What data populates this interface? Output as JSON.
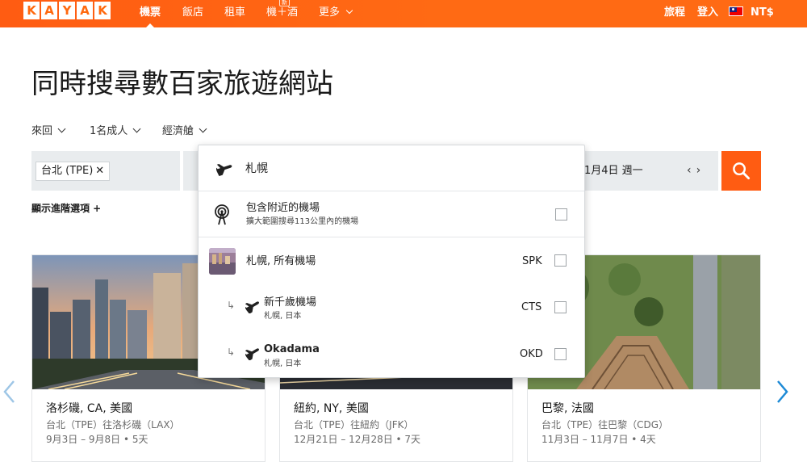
{
  "logo": {
    "letters": [
      "K",
      "A",
      "Y",
      "A",
      "K"
    ]
  },
  "nav": {
    "items": [
      {
        "label": "機票",
        "active": true
      },
      {
        "label": "飯店",
        "active": false
      },
      {
        "label": "租車",
        "active": false
      },
      {
        "label": "機＋酒",
        "active": false
      },
      {
        "label": "更多",
        "active": false
      }
    ],
    "badge": "新",
    "trips": "旅程",
    "login": "登入",
    "currency": "NT$"
  },
  "headline": "同時搜尋數百家旅遊網站",
  "options": {
    "trip_type": "來回",
    "travelers": "1名成人",
    "cabin": "經濟艙"
  },
  "search": {
    "origin": "台北 (TPE)",
    "origin_remove": "✕",
    "date": "1月4日 週一",
    "date_prev": "‹",
    "date_next": "›"
  },
  "advanced": "顯示進階選項 +",
  "dropdown": {
    "query": "札幌",
    "nearby": {
      "title": "包含附近的機場",
      "subtitle": "擴大範圍搜尋113公里內的機場"
    },
    "results": [
      {
        "name": "札幌, 所有機場",
        "subtitle": "",
        "code": "SPK"
      },
      {
        "name": "新千歲機場",
        "subtitle": "札幌, 日本",
        "code": "CTS"
      },
      {
        "name": "Okadama",
        "subtitle": "札幌, 日本",
        "code": "OKD"
      }
    ]
  },
  "cards": [
    {
      "title": "洛杉磯, CA, 美國",
      "route": "台北（TPE）往洛杉磯（LAX）",
      "dates": "9月3日 – 9月8日 • 5天"
    },
    {
      "title": "紐約, NY, 美國",
      "route": "台北（TPE）往紐約（JFK）",
      "dates": "12月21日 – 12月28日 • 7天"
    },
    {
      "title": "巴黎, 法國",
      "route": "台北（TPE）往巴黎（CDG）",
      "dates": "11月3日 – 11月7日 • 4天"
    }
  ],
  "colors": {
    "brand": "#ff690f",
    "carousel_arrow": "#1d8ad6"
  }
}
